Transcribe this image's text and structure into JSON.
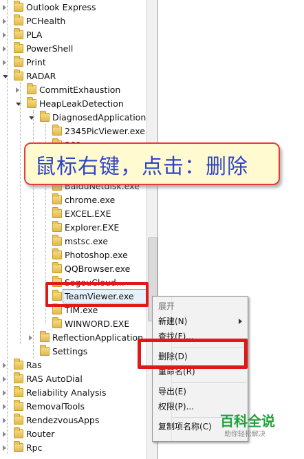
{
  "tree": {
    "items": [
      {
        "label": "Outlook Express",
        "indent": 0,
        "state": "closed"
      },
      {
        "label": "PCHealth",
        "indent": 0,
        "state": "closed"
      },
      {
        "label": "PLA",
        "indent": 0,
        "state": "closed"
      },
      {
        "label": "PowerShell",
        "indent": 0,
        "state": "closed"
      },
      {
        "label": "Print",
        "indent": 0,
        "state": "closed"
      },
      {
        "label": "RADAR",
        "indent": 0,
        "state": "open"
      },
      {
        "label": "CommitExhaustion",
        "indent": 1,
        "state": "closed"
      },
      {
        "label": "HeapLeakDetection",
        "indent": 1,
        "state": "open"
      },
      {
        "label": "DiagnosedApplications",
        "indent": 2,
        "state": "open"
      },
      {
        "label": "2345PicViewer.exe",
        "indent": 3,
        "state": "none"
      },
      {
        "label": "360...",
        "indent": 3,
        "state": "none"
      },
      {
        "label": "",
        "indent": 3,
        "state": "none"
      },
      {
        "label": "",
        "indent": 3,
        "state": "none"
      },
      {
        "label": "BaiduNetdisk.exe",
        "indent": 3,
        "state": "none"
      },
      {
        "label": "chrome.exe",
        "indent": 3,
        "state": "none"
      },
      {
        "label": "EXCEL.EXE",
        "indent": 3,
        "state": "none"
      },
      {
        "label": "Explorer.EXE",
        "indent": 3,
        "state": "none"
      },
      {
        "label": "mstsc.exe",
        "indent": 3,
        "state": "none"
      },
      {
        "label": "Photoshop.exe",
        "indent": 3,
        "state": "none"
      },
      {
        "label": "QQBrowser.exe",
        "indent": 3,
        "state": "none"
      },
      {
        "label": "SogouCloud...",
        "indent": 3,
        "state": "none"
      },
      {
        "label": "TeamViewer.exe",
        "indent": 3,
        "state": "selected"
      },
      {
        "label": "TIM.exe",
        "indent": 3,
        "state": "none"
      },
      {
        "label": "WINWORD.EXE",
        "indent": 3,
        "state": "none"
      },
      {
        "label": "ReflectionApplication",
        "indent": 2,
        "state": "closed"
      },
      {
        "label": "Settings",
        "indent": 2,
        "state": "none"
      },
      {
        "label": "Ras",
        "indent": 0,
        "state": "closed"
      },
      {
        "label": "RAS AutoDial",
        "indent": 0,
        "state": "closed"
      },
      {
        "label": "Reliability Analysis",
        "indent": 0,
        "state": "closed"
      },
      {
        "label": "RemovalTools",
        "indent": 0,
        "state": "closed"
      },
      {
        "label": "RendezvousApps",
        "indent": 0,
        "state": "closed"
      },
      {
        "label": "Router",
        "indent": 0,
        "state": "closed"
      },
      {
        "label": "Rpc",
        "indent": 0,
        "state": "closed"
      }
    ]
  },
  "banner": {
    "text": "鼠标右键，点击：删除"
  },
  "context_menu": {
    "items": [
      {
        "label": "展开",
        "disabled": true
      },
      {
        "label": "新建(N)",
        "disabled": false,
        "submenu": true
      },
      {
        "label": "查找(F)...",
        "disabled": false
      },
      {
        "separator": true
      },
      {
        "label": "删除(D)",
        "disabled": false
      },
      {
        "label": "重命名(R)",
        "disabled": false
      },
      {
        "separator": true
      },
      {
        "label": "导出(E)",
        "disabled": false
      },
      {
        "label": "权限(P)...",
        "disabled": false
      },
      {
        "separator": true
      },
      {
        "label": "复制项名称(C)",
        "disabled": false
      }
    ]
  },
  "watermark": {
    "title": "百科全说",
    "subtitle": "助你轻松解决"
  },
  "colors": {
    "highlight_red": "#e01818",
    "banner_text": "#2f44c8",
    "banner_bg": "#fffad0",
    "folder": "#e9c45d"
  }
}
